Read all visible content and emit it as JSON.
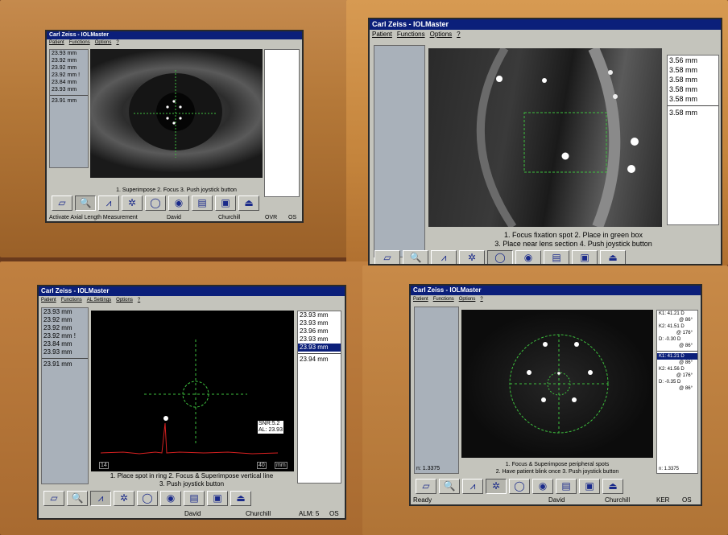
{
  "screens": {
    "s1": {
      "title": "Carl Zeiss - IOLMaster",
      "menu": [
        "Patient",
        "Functions",
        "Options",
        "?"
      ],
      "left_values": [
        "23.93 mm",
        "23.92 mm",
        "23.92 mm",
        "23.92 mm !",
        "23.84 mm",
        "23.93 mm"
      ],
      "left_avg": "23.91 mm",
      "instruction": "1. Superimpose 2. Focus 3. Push joystick button",
      "status_message": "Activate Axial Length Measurement",
      "status_first": "David",
      "status_last": "Churchill",
      "status_mode": "OVR",
      "status_eye": "OS"
    },
    "s2": {
      "title": "Carl Zeiss - IOLMaster",
      "menu": [
        "Patient",
        "Functions",
        "Options",
        "?"
      ],
      "right_values": [
        "3.56 mm",
        "3.58 mm",
        "3.58 mm",
        "3.58 mm",
        "3.58 mm"
      ],
      "right_avg": "3.58 mm",
      "instruction_1": "1. Focus fixation spot 2. Place in green box",
      "instruction_2": "3. Place near lens section 4. Push joystick button"
    },
    "s3": {
      "title": "Carl Zeiss - IOLMaster",
      "menu": [
        "Patient",
        "Functions",
        "AL Settings",
        "Options",
        "?"
      ],
      "left_values": [
        "23.93 mm",
        "23.92 mm",
        "23.92 mm",
        "23.92 mm !",
        "23.84 mm",
        "23.93 mm"
      ],
      "left_avg": "23.91 mm",
      "right_values": [
        "23.93 mm",
        "23.93 mm",
        "23.96 mm",
        "23.93 mm",
        "23.93 mm"
      ],
      "right_avg": "23.94 mm",
      "snr": "SNR:5.2",
      "al": "AL: 23.93",
      "axis_left": "14",
      "axis_right": "40",
      "axis_unit": "mm",
      "instruction_1": "1. Place spot in ring 2. Focus & Superimpose vertical line",
      "instruction_2": "3. Push joystick button",
      "status_first": "David",
      "status_last": "Churchill",
      "status_mode": "ALM: 5",
      "status_eye": "OS"
    },
    "s4": {
      "title": "Carl Zeiss - IOLMaster",
      "menu": [
        "Patient",
        "Functions",
        "Options",
        "?"
      ],
      "ker_block1": [
        "K1: 41.21 D",
        "@ 86°",
        "K2: 41.51 D",
        "@ 176°",
        "D: -0.30 D",
        "@ 86°"
      ],
      "ker_block2": [
        "K1: 41.21 D",
        "@ 86°",
        "K2: 41.56 D",
        "@ 176°",
        "D: -0.35 D",
        "@ 86°"
      ],
      "n_left": "n: 1.3375",
      "n_right": "n: 1.3375",
      "instruction_1": "1. Focus & Superimpose peripheral spots",
      "instruction_2": "2. Have patient blink once 3. Push joystick button",
      "status_message": "Ready",
      "status_first": "David",
      "status_last": "Churchill",
      "status_mode": "KER",
      "status_eye": "OS"
    }
  },
  "colors": {
    "title_bar": "#0b1f7a",
    "crosshair": "#3ec03e",
    "signal": "#d62020",
    "window_bg": "#c4c4bc"
  }
}
